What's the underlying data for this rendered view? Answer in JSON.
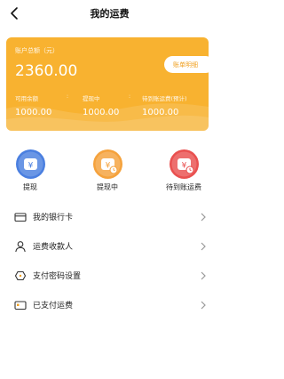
{
  "header": {
    "title": "我的运费",
    "back_icon": "chevron-left-icon"
  },
  "card": {
    "balance_label": "账户总额（元）",
    "balance_amount": "2360.00",
    "bill_button": "账单明细",
    "stats": [
      {
        "label": "可用余额",
        "value": "1000.00"
      },
      {
        "label": "提现中",
        "value": "1000.00"
      },
      {
        "label": "待到账运费(预计)",
        "value": "1000.00"
      }
    ],
    "separator": ":"
  },
  "actions": [
    {
      "label": "提现",
      "icon": "yen-icon",
      "color": "#4a7fe0"
    },
    {
      "label": "提现中",
      "icon": "yen-clock-icon",
      "color": "#f5a23c"
    },
    {
      "label": "待到账运费",
      "icon": "yen-clock-icon",
      "color": "#e9504f"
    }
  ],
  "menu": [
    {
      "label": "我的银行卡",
      "icon": "card-icon"
    },
    {
      "label": "运费收款人",
      "icon": "person-icon"
    },
    {
      "label": "支付密码设置",
      "icon": "shield-icon"
    },
    {
      "label": "已支付运费",
      "icon": "wallet-icon"
    }
  ],
  "colors": {
    "card": "#f8b230",
    "accent": "#f0a020"
  }
}
